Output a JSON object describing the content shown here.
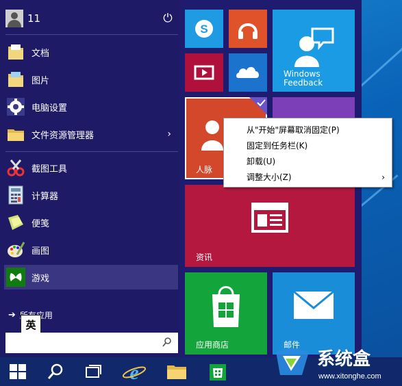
{
  "user": {
    "name": "11"
  },
  "places": [
    {
      "label": "文档",
      "icon": "documents-folder-icon"
    },
    {
      "label": "图片",
      "icon": "pictures-folder-icon"
    },
    {
      "label": "电脑设置",
      "icon": "gear-icon"
    },
    {
      "label": "文件资源管理器",
      "icon": "file-explorer-icon",
      "submenu": "›"
    }
  ],
  "apps": [
    {
      "label": "截图工具",
      "icon": "snipping-tool-icon"
    },
    {
      "label": "计算器",
      "icon": "calculator-icon"
    },
    {
      "label": "便笺",
      "icon": "sticky-notes-icon"
    },
    {
      "label": "画图",
      "icon": "paint-icon"
    },
    {
      "label": "游戏",
      "icon": "xbox-games-icon"
    }
  ],
  "all_apps": {
    "label": "所有应用",
    "arrow": "➔"
  },
  "ime": {
    "label": "英"
  },
  "search": {
    "placeholder": ""
  },
  "tiles": {
    "windows_feedback": {
      "label": "Windows\nFeedback"
    },
    "people": {
      "label": "人脉"
    },
    "news": {
      "label": "资讯"
    },
    "store": {
      "label": "应用商店"
    },
    "mail": {
      "label": "邮件"
    }
  },
  "context_menu": {
    "items": [
      {
        "label": "从\"开始\"屏幕取消固定(P)"
      },
      {
        "label": "固定到任务栏(K)"
      },
      {
        "label": "卸载(U)"
      },
      {
        "label": "调整大小(Z)",
        "submenu": "›"
      }
    ]
  },
  "watermark": {
    "brand": "系统盒",
    "url": "www.xitonghe.com"
  },
  "colors": {
    "start_bg": "#1f1b6f",
    "skype": "#1e9be3",
    "music": "#e0532a",
    "video": "#b0113c",
    "onedrive": "#1b73cd",
    "feedback": "#1b9be3",
    "people": "#d3472b",
    "purple": "#7d3fb8",
    "news": "#b4183f",
    "store": "#13a53c",
    "mail": "#1a8dd9",
    "taskbar": "#11296a"
  }
}
